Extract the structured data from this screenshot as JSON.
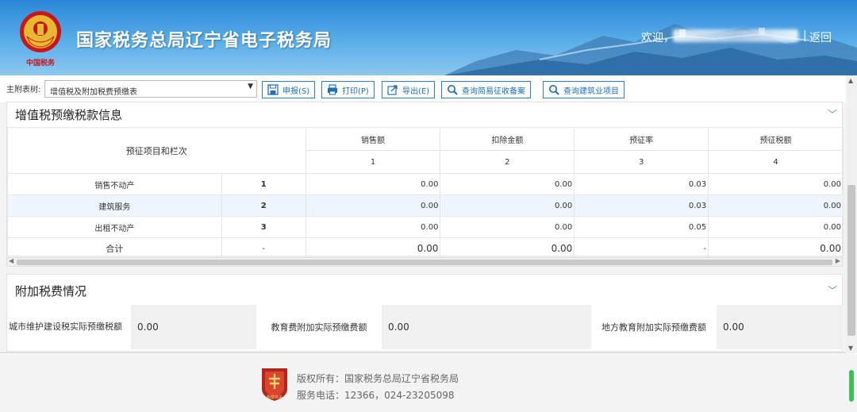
{
  "header": {
    "site_title": "国家税务总局辽宁省电子税务局",
    "welcome": "欢迎，",
    "separator": "|",
    "back": "返回",
    "emblem_caption": "中国税务"
  },
  "toolbar": {
    "label": "主附表树:",
    "select_value": "增值税及附加税费预缴表",
    "buttons": [
      {
        "label": "申报(S)",
        "icon": "save-icon"
      },
      {
        "label": "打印(P)",
        "icon": "printer-icon"
      },
      {
        "label": "导出(E)",
        "icon": "export-icon"
      },
      {
        "label": "查询简易征收备案",
        "icon": "search-icon"
      },
      {
        "label": "查询建筑业项目",
        "icon": "search-icon"
      }
    ]
  },
  "vat_section": {
    "title": "增值税预缴税款信息",
    "header_item": "预征项目和栏次",
    "columns": [
      {
        "label": "销售额",
        "num": "1"
      },
      {
        "label": "扣除金额",
        "num": "2"
      },
      {
        "label": "预征率",
        "num": "3"
      },
      {
        "label": "预征税额",
        "num": "4"
      }
    ],
    "rows": [
      {
        "item": "销售不动产",
        "line": "1",
        "v1": "0.00",
        "v2": "0.00",
        "v3": "0.03",
        "v4": "0.00"
      },
      {
        "item": "建筑服务",
        "line": "2",
        "v1": "0.00",
        "v2": "0.00",
        "v3": "0.03",
        "v4": "0.00"
      },
      {
        "item": "出租不动产",
        "line": "3",
        "v1": "0.00",
        "v2": "0.00",
        "v3": "0.05",
        "v4": "0.00"
      },
      {
        "item": "合计",
        "line": "-",
        "v1": "0.00",
        "v2": "0.00",
        "v3": "-",
        "v4": "0.00"
      }
    ]
  },
  "fee_section": {
    "title": "附加税费情况",
    "items": [
      {
        "label": "城市维护建设税实际预缴税额",
        "value": "0.00"
      },
      {
        "label": "教育费附加实际预缴费额",
        "value": "0.00"
      },
      {
        "label": "地方教育附加实际预缴费额",
        "value": "0.00"
      }
    ]
  },
  "footer": {
    "copyright": "版权所有：国家税务总局辽宁省税务局",
    "phone": "服务电话：12366，024-23205098",
    "logo_caption": "税徽纳关"
  },
  "colors": {
    "header_blue": "#2a86d8",
    "button_blue": "#1f6fb8",
    "emblem_red": "#c8161d",
    "highlight_row": "#eef5fc"
  }
}
